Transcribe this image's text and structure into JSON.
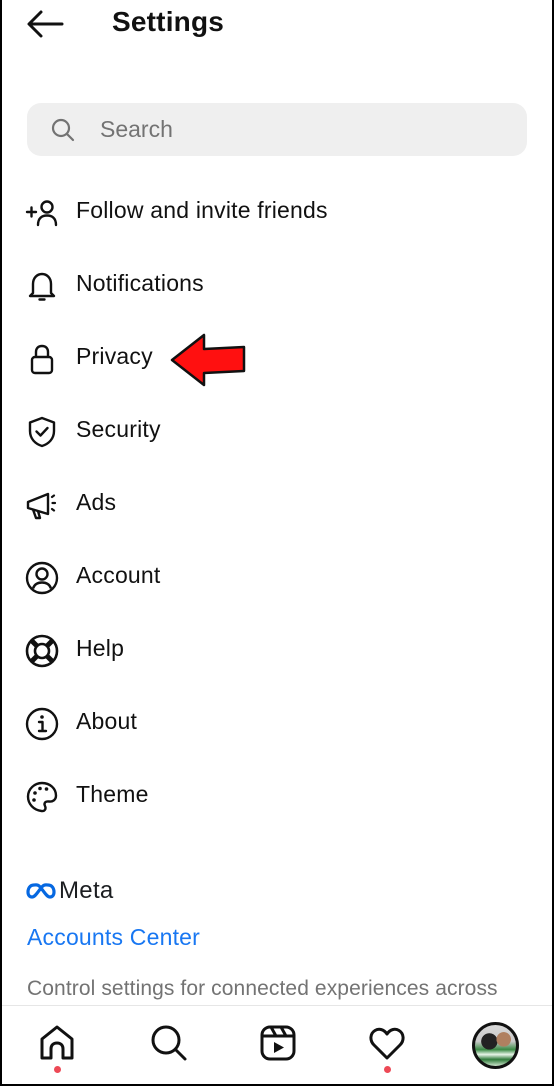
{
  "header": {
    "back_icon": "arrow-left-icon",
    "title": "Settings"
  },
  "search": {
    "icon": "search-icon",
    "placeholder": "Search"
  },
  "menu": {
    "items": [
      {
        "label": "Follow and invite friends",
        "icon": "add-person-icon"
      },
      {
        "label": "Notifications",
        "icon": "bell-icon"
      },
      {
        "label": "Privacy",
        "icon": "lock-icon"
      },
      {
        "label": "Security",
        "icon": "shield-check-icon"
      },
      {
        "label": "Ads",
        "icon": "megaphone-icon"
      },
      {
        "label": "Account",
        "icon": "account-circle-icon"
      },
      {
        "label": "Help",
        "icon": "lifebuoy-icon"
      },
      {
        "label": "About",
        "icon": "info-icon"
      },
      {
        "label": "Theme",
        "icon": "palette-icon"
      }
    ]
  },
  "annotation": {
    "icon": "red-arrow-icon",
    "color": "#ff0000",
    "points_to": "Privacy"
  },
  "meta": {
    "logo_icon": "meta-infinity-icon",
    "wordmark": "Meta",
    "accounts_center_label": "Accounts Center",
    "accounts_center_desc": "Control settings for connected experiences across",
    "link_color": "#1877f2"
  },
  "bottom_nav": {
    "items": [
      {
        "name": "home",
        "icon": "home-icon",
        "has_dot": true
      },
      {
        "name": "search",
        "icon": "search-icon",
        "has_dot": false
      },
      {
        "name": "reels",
        "icon": "reels-icon",
        "has_dot": false
      },
      {
        "name": "activity",
        "icon": "heart-icon",
        "has_dot": true
      },
      {
        "name": "profile",
        "icon": "profile-avatar",
        "has_dot": false
      }
    ],
    "notification_dot_color": "#ed4956"
  }
}
